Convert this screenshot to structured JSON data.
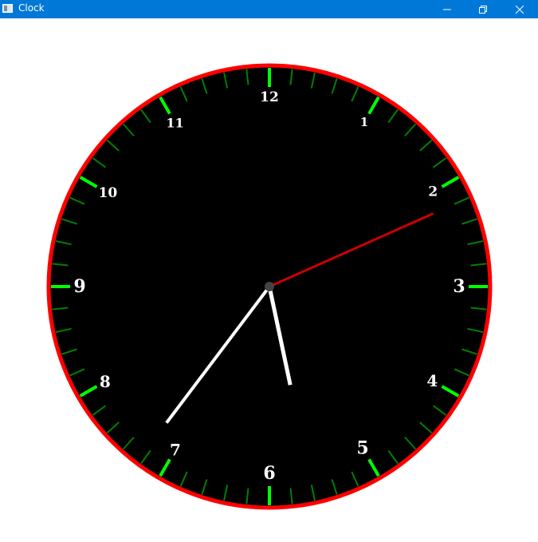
{
  "window": {
    "title": "Clock",
    "controls": {
      "minimize_icon": "minimize-icon",
      "maximize_icon": "restore-icon",
      "close_icon": "close-icon"
    }
  },
  "clock": {
    "numerals": [
      "12",
      "1",
      "2",
      "3",
      "4",
      "5",
      "6",
      "7",
      "8",
      "9",
      "10",
      "11"
    ],
    "time": {
      "hour": 5,
      "minute": 36,
      "second": 11
    },
    "colors": {
      "face": "#000000",
      "rim": "#ff0000",
      "major_tick": "#00ff00",
      "minor_tick": "#008000",
      "numerals": "#ffffff",
      "hands": "#ffffff",
      "second_hand": "#cc0000",
      "hub": "#444444",
      "titlebar": "#0078d7"
    }
  }
}
